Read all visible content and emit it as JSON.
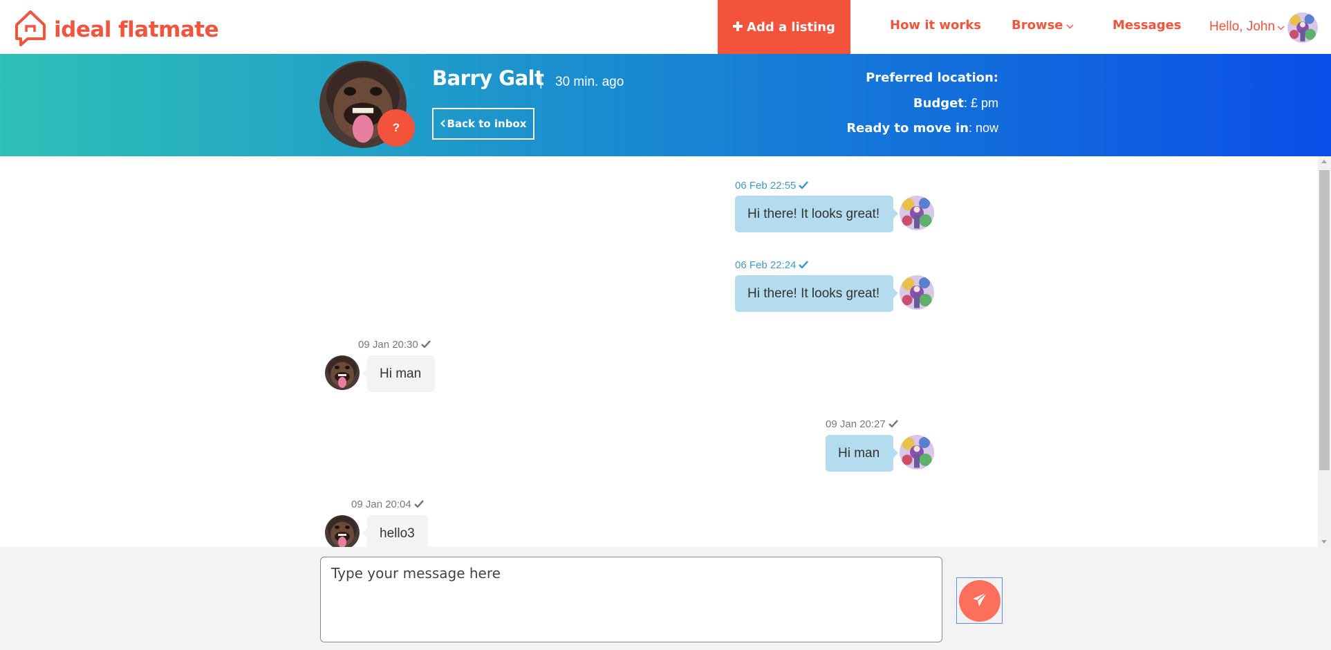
{
  "nav": {
    "logo_text": "ideal flatmate",
    "add_listing": "Add a listing",
    "how_it_works": "How it works",
    "browse": "Browse",
    "messages": "Messages",
    "greeting": "Hello, John"
  },
  "profile": {
    "name": "Barry Galt",
    "separator": "|",
    "last_seen": "30 min. ago",
    "badge": "?",
    "back_label": "Back to inbox",
    "preferred_location_label": "Preferred location:",
    "preferred_location_value": "",
    "budget_label": "Budget",
    "budget_value": ": £ pm",
    "move_in_label": "Ready to move in",
    "move_in_value": ": now"
  },
  "messages": [
    {
      "time": "06 Feb 22:55",
      "text": "Hi there! It looks great!",
      "direction": "sent"
    },
    {
      "time": "06 Feb 22:24",
      "text": "Hi there! It looks great!",
      "direction": "sent"
    },
    {
      "time": "09 Jan 20:30",
      "text": "Hi man",
      "direction": "received"
    },
    {
      "time": "09 Jan 20:27",
      "text": "Hi man",
      "direction": "sent"
    },
    {
      "time": "09 Jan 20:04",
      "text": "hello3",
      "direction": "received"
    }
  ],
  "composer": {
    "placeholder": "Type your message here"
  },
  "icons": {
    "logo": "house-chat-icon",
    "add": "plus-icon",
    "browse_caret": "chevron-down-icon",
    "back": "chevron-left-icon",
    "read_receipt": "check-icon",
    "send": "paper-plane-icon"
  },
  "colors": {
    "brand": "#f2553d",
    "banner_start": "#2ec1b7",
    "banner_end": "#0b4ee8",
    "sent_bubble": "#b4dcee",
    "received_bubble": "#f3f3f3",
    "send_button": "#fb6f5c"
  }
}
